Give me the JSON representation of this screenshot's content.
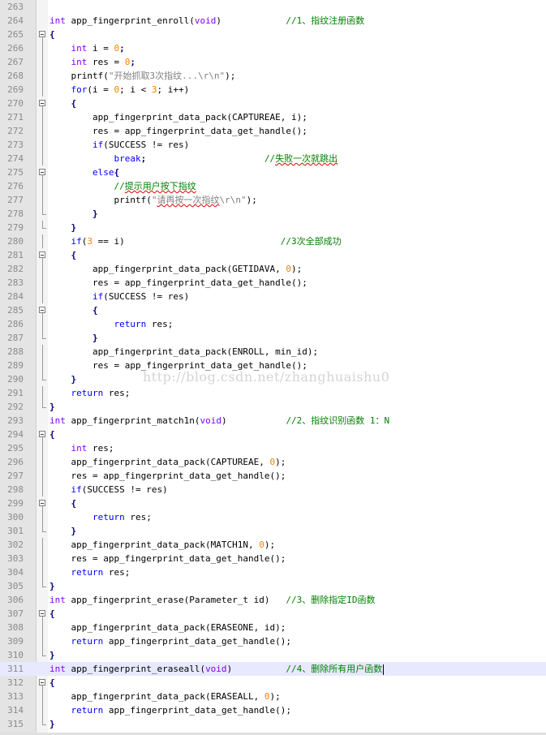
{
  "editor": {
    "current_line": 311,
    "watermark": "http://blog.csdn.net/zhanghuaishu0",
    "lines": [
      {
        "n": "263",
        "fold": "none",
        "t": []
      },
      {
        "n": "264",
        "fold": "none",
        "t": [
          [
            "type",
            "int"
          ],
          [
            "p",
            " app_fingerprint_enroll("
          ],
          [
            "type",
            "void"
          ],
          [
            "p",
            ")            "
          ],
          [
            "com",
            "//1、指纹注册函数"
          ]
        ]
      },
      {
        "n": "265",
        "fold": "open",
        "t": [
          [
            "op",
            "{"
          ]
        ]
      },
      {
        "n": "266",
        "fold": "line",
        "t": [
          [
            "p",
            "    "
          ],
          [
            "type",
            "int"
          ],
          [
            "p",
            " i = "
          ],
          [
            "num",
            "0"
          ],
          [
            "op",
            ";"
          ]
        ]
      },
      {
        "n": "267",
        "fold": "line",
        "t": [
          [
            "p",
            "    "
          ],
          [
            "type",
            "int"
          ],
          [
            "p",
            " res = "
          ],
          [
            "num",
            "0"
          ],
          [
            "op",
            ";"
          ]
        ]
      },
      {
        "n": "268",
        "fold": "line",
        "t": [
          [
            "p",
            "    printf("
          ],
          [
            "str",
            "\"开始抓取3次指纹...\\r\\n\""
          ],
          [
            "p",
            ");"
          ]
        ]
      },
      {
        "n": "269",
        "fold": "line",
        "t": [
          [
            "p",
            "    "
          ],
          [
            "kw",
            "for"
          ],
          [
            "p",
            "(i = "
          ],
          [
            "num",
            "0"
          ],
          [
            "p",
            "; i < "
          ],
          [
            "num",
            "3"
          ],
          [
            "p",
            "; i++)"
          ]
        ]
      },
      {
        "n": "270",
        "fold": "open",
        "t": [
          [
            "p",
            "    "
          ],
          [
            "op",
            "{"
          ]
        ]
      },
      {
        "n": "271",
        "fold": "line",
        "t": [
          [
            "p",
            "        app_fingerprint_data_pack(CAPTUREAE, i);"
          ]
        ]
      },
      {
        "n": "272",
        "fold": "line",
        "t": [
          [
            "p",
            "        res = app_fingerprint_data_get_handle();"
          ]
        ]
      },
      {
        "n": "273",
        "fold": "line",
        "t": [
          [
            "p",
            "        "
          ],
          [
            "kw",
            "if"
          ],
          [
            "p",
            "(SUCCESS != res)"
          ]
        ]
      },
      {
        "n": "274",
        "fold": "line",
        "t": [
          [
            "p",
            "            "
          ],
          [
            "kw",
            "break"
          ],
          [
            "op",
            ";"
          ],
          [
            "p",
            "                      "
          ],
          [
            "com",
            "//失败一次就跳出"
          ]
        ]
      },
      {
        "n": "275",
        "fold": "open",
        "t": [
          [
            "p",
            "        "
          ],
          [
            "kw",
            "else"
          ],
          [
            "op",
            "{"
          ]
        ]
      },
      {
        "n": "276",
        "fold": "line",
        "t": [
          [
            "p",
            "            "
          ],
          [
            "com",
            "//提示用户按下指纹"
          ]
        ]
      },
      {
        "n": "277",
        "fold": "line",
        "t": [
          [
            "p",
            "            printf("
          ],
          [
            "str",
            "\"请再按一次指纹\\r\\n\""
          ],
          [
            "p",
            ");"
          ]
        ]
      },
      {
        "n": "278",
        "fold": "end",
        "t": [
          [
            "p",
            "        "
          ],
          [
            "op",
            "}"
          ]
        ]
      },
      {
        "n": "279",
        "fold": "end",
        "t": [
          [
            "p",
            "    "
          ],
          [
            "op",
            "}"
          ]
        ]
      },
      {
        "n": "280",
        "fold": "line",
        "t": [
          [
            "p",
            "    "
          ],
          [
            "kw",
            "if"
          ],
          [
            "p",
            "("
          ],
          [
            "num",
            "3"
          ],
          [
            "p",
            " == i)                             "
          ],
          [
            "com",
            "//3次全部成功"
          ]
        ]
      },
      {
        "n": "281",
        "fold": "open",
        "t": [
          [
            "p",
            "    "
          ],
          [
            "op",
            "{"
          ]
        ]
      },
      {
        "n": "282",
        "fold": "line",
        "t": [
          [
            "p",
            "        app_fingerprint_data_pack(GETIDAVA, "
          ],
          [
            "num",
            "0"
          ],
          [
            "p",
            ");"
          ]
        ]
      },
      {
        "n": "283",
        "fold": "line",
        "t": [
          [
            "p",
            "        res = app_fingerprint_data_get_handle();"
          ]
        ]
      },
      {
        "n": "284",
        "fold": "line",
        "t": [
          [
            "p",
            "        "
          ],
          [
            "kw",
            "if"
          ],
          [
            "p",
            "(SUCCESS != res)"
          ]
        ]
      },
      {
        "n": "285",
        "fold": "open",
        "t": [
          [
            "p",
            "        "
          ],
          [
            "op",
            "{"
          ]
        ]
      },
      {
        "n": "286",
        "fold": "line",
        "t": [
          [
            "p",
            "            "
          ],
          [
            "kw",
            "return"
          ],
          [
            "p",
            " res;"
          ]
        ]
      },
      {
        "n": "287",
        "fold": "end",
        "t": [
          [
            "p",
            "        "
          ],
          [
            "op",
            "}"
          ]
        ]
      },
      {
        "n": "288",
        "fold": "line",
        "t": [
          [
            "p",
            "        app_fingerprint_data_pack(ENROLL, min_id);"
          ]
        ]
      },
      {
        "n": "289",
        "fold": "line",
        "t": [
          [
            "p",
            "        res = app_fingerprint_data_get_handle();"
          ]
        ]
      },
      {
        "n": "290",
        "fold": "end",
        "t": [
          [
            "p",
            "    "
          ],
          [
            "op",
            "}"
          ]
        ]
      },
      {
        "n": "291",
        "fold": "line",
        "t": [
          [
            "p",
            "    "
          ],
          [
            "kw",
            "return"
          ],
          [
            "p",
            " res;"
          ]
        ]
      },
      {
        "n": "292",
        "fold": "end",
        "t": [
          [
            "op",
            "}"
          ]
        ]
      },
      {
        "n": "293",
        "fold": "none",
        "t": [
          [
            "type",
            "int"
          ],
          [
            "p",
            " app_fingerprint_match1n("
          ],
          [
            "type",
            "void"
          ],
          [
            "p",
            ")           "
          ],
          [
            "com",
            "//2、指纹识别函数 1：N"
          ]
        ]
      },
      {
        "n": "294",
        "fold": "open",
        "t": [
          [
            "op",
            "{"
          ]
        ]
      },
      {
        "n": "295",
        "fold": "line",
        "t": [
          [
            "p",
            "    "
          ],
          [
            "type",
            "int"
          ],
          [
            "p",
            " res;"
          ]
        ]
      },
      {
        "n": "296",
        "fold": "line",
        "t": [
          [
            "p",
            "    app_fingerprint_data_pack(CAPTUREAE, "
          ],
          [
            "num",
            "0"
          ],
          [
            "p",
            ");"
          ]
        ]
      },
      {
        "n": "297",
        "fold": "line",
        "t": [
          [
            "p",
            "    res = app_fingerprint_data_get_handle();"
          ]
        ]
      },
      {
        "n": "298",
        "fold": "line",
        "t": [
          [
            "p",
            "    "
          ],
          [
            "kw",
            "if"
          ],
          [
            "p",
            "(SUCCESS != res)"
          ]
        ]
      },
      {
        "n": "299",
        "fold": "open",
        "t": [
          [
            "p",
            "    "
          ],
          [
            "op",
            "{"
          ]
        ]
      },
      {
        "n": "300",
        "fold": "line",
        "t": [
          [
            "p",
            "        "
          ],
          [
            "kw",
            "return"
          ],
          [
            "p",
            " res;"
          ]
        ]
      },
      {
        "n": "301",
        "fold": "end",
        "t": [
          [
            "p",
            "    "
          ],
          [
            "op",
            "}"
          ]
        ]
      },
      {
        "n": "302",
        "fold": "line",
        "t": [
          [
            "p",
            "    app_fingerprint_data_pack(MATCH1N, "
          ],
          [
            "num",
            "0"
          ],
          [
            "p",
            ");"
          ]
        ]
      },
      {
        "n": "303",
        "fold": "line",
        "t": [
          [
            "p",
            "    res = app_fingerprint_data_get_handle();"
          ]
        ]
      },
      {
        "n": "304",
        "fold": "line",
        "t": [
          [
            "p",
            "    "
          ],
          [
            "kw",
            "return"
          ],
          [
            "p",
            " res;"
          ]
        ]
      },
      {
        "n": "305",
        "fold": "end",
        "t": [
          [
            "op",
            "}"
          ]
        ]
      },
      {
        "n": "306",
        "fold": "none",
        "t": [
          [
            "type",
            "int"
          ],
          [
            "p",
            " app_fingerprint_erase(Parameter_t id)   "
          ],
          [
            "com",
            "//3、删除指定ID函数"
          ]
        ]
      },
      {
        "n": "307",
        "fold": "open",
        "t": [
          [
            "op",
            "{"
          ]
        ]
      },
      {
        "n": "308",
        "fold": "line",
        "t": [
          [
            "p",
            "    app_fingerprint_data_pack(ERASEONE, id);"
          ]
        ]
      },
      {
        "n": "309",
        "fold": "line",
        "t": [
          [
            "p",
            "    "
          ],
          [
            "kw",
            "return"
          ],
          [
            "p",
            " app_fingerprint_data_get_handle();"
          ]
        ]
      },
      {
        "n": "310",
        "fold": "end",
        "t": [
          [
            "op",
            "}"
          ]
        ]
      },
      {
        "n": "311",
        "fold": "none",
        "t": [
          [
            "type",
            "int"
          ],
          [
            "p",
            " app_fingerprint_eraseall("
          ],
          [
            "type",
            "void"
          ],
          [
            "p",
            ")          "
          ],
          [
            "com",
            "//4、删除所有用户函数"
          ]
        ]
      },
      {
        "n": "312",
        "fold": "open",
        "t": [
          [
            "op",
            "{"
          ]
        ]
      },
      {
        "n": "313",
        "fold": "line",
        "t": [
          [
            "p",
            "    app_fingerprint_data_pack(ERASEALL, "
          ],
          [
            "num",
            "0"
          ],
          [
            "p",
            ");"
          ]
        ]
      },
      {
        "n": "314",
        "fold": "line",
        "t": [
          [
            "p",
            "    "
          ],
          [
            "kw",
            "return"
          ],
          [
            "p",
            " app_fingerprint_data_get_handle();"
          ]
        ]
      },
      {
        "n": "315",
        "fold": "end",
        "t": [
          [
            "op",
            "}"
          ]
        ]
      }
    ],
    "squiggles": [
      "失败一次就跳出",
      "提示用户按下指纹",
      "请再按一次指纹"
    ]
  }
}
